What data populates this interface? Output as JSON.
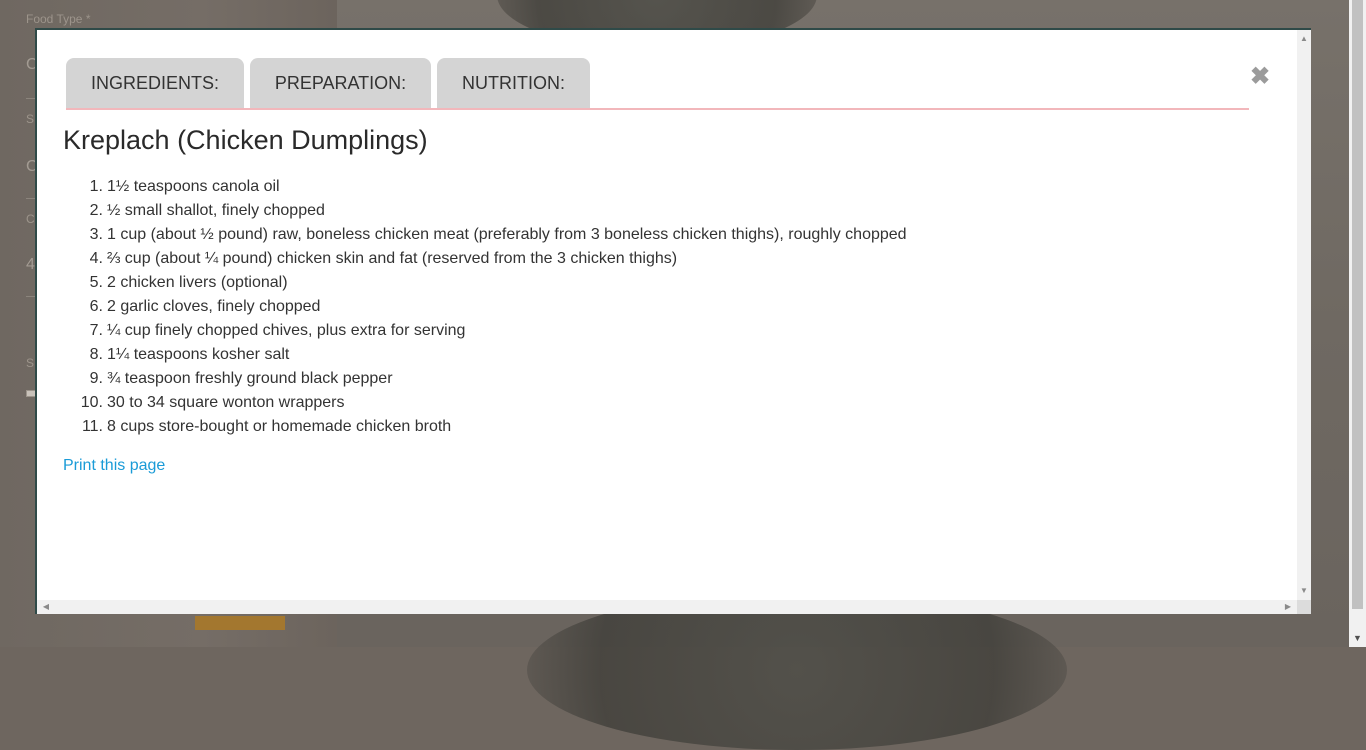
{
  "background": {
    "form_label": "Food Type *",
    "fragment_chars": [
      "C",
      "S",
      "C",
      "C",
      "4",
      "S"
    ]
  },
  "modal": {
    "tabs": [
      {
        "label": "INGREDIENTS:"
      },
      {
        "label": "PREPARATION:"
      },
      {
        "label": "NUTRITION:"
      }
    ],
    "close_symbol": "✖",
    "title": "Kreplach (Chicken Dumplings)",
    "ingredients": [
      {
        "num": "1.",
        "text": "1½ teaspoons canola oil"
      },
      {
        "num": "2.",
        "text": "½ small shallot, finely chopped"
      },
      {
        "num": "3.",
        "text": "1 cup (about ½ pound) raw, boneless chicken meat (preferably from 3 boneless chicken thighs), roughly chopped"
      },
      {
        "num": "4.",
        "text": "⅔ cup (about ¼ pound) chicken skin and fat (reserved from the 3 chicken thighs)"
      },
      {
        "num": "5.",
        "text": "2 chicken livers (optional)"
      },
      {
        "num": "6.",
        "text": "2 garlic cloves, finely chopped"
      },
      {
        "num": "7.",
        "text": "¼ cup finely chopped chives, plus extra for serving"
      },
      {
        "num": "8.",
        "text": "1¼ teaspoons kosher salt"
      },
      {
        "num": "9.",
        "text": "¾ teaspoon freshly ground black pepper"
      },
      {
        "num": "10.",
        "text": "30 to 34 square wonton wrappers"
      },
      {
        "num": "11.",
        "text": "8 cups store-bought or homemade chicken broth"
      }
    ],
    "print_link": "Print this page"
  },
  "colors": {
    "modal_border": "#2f4a48",
    "tab_bg": "#d4d4d4",
    "tab_underline": "#f2b7bb",
    "link": "#1a9bd7"
  }
}
